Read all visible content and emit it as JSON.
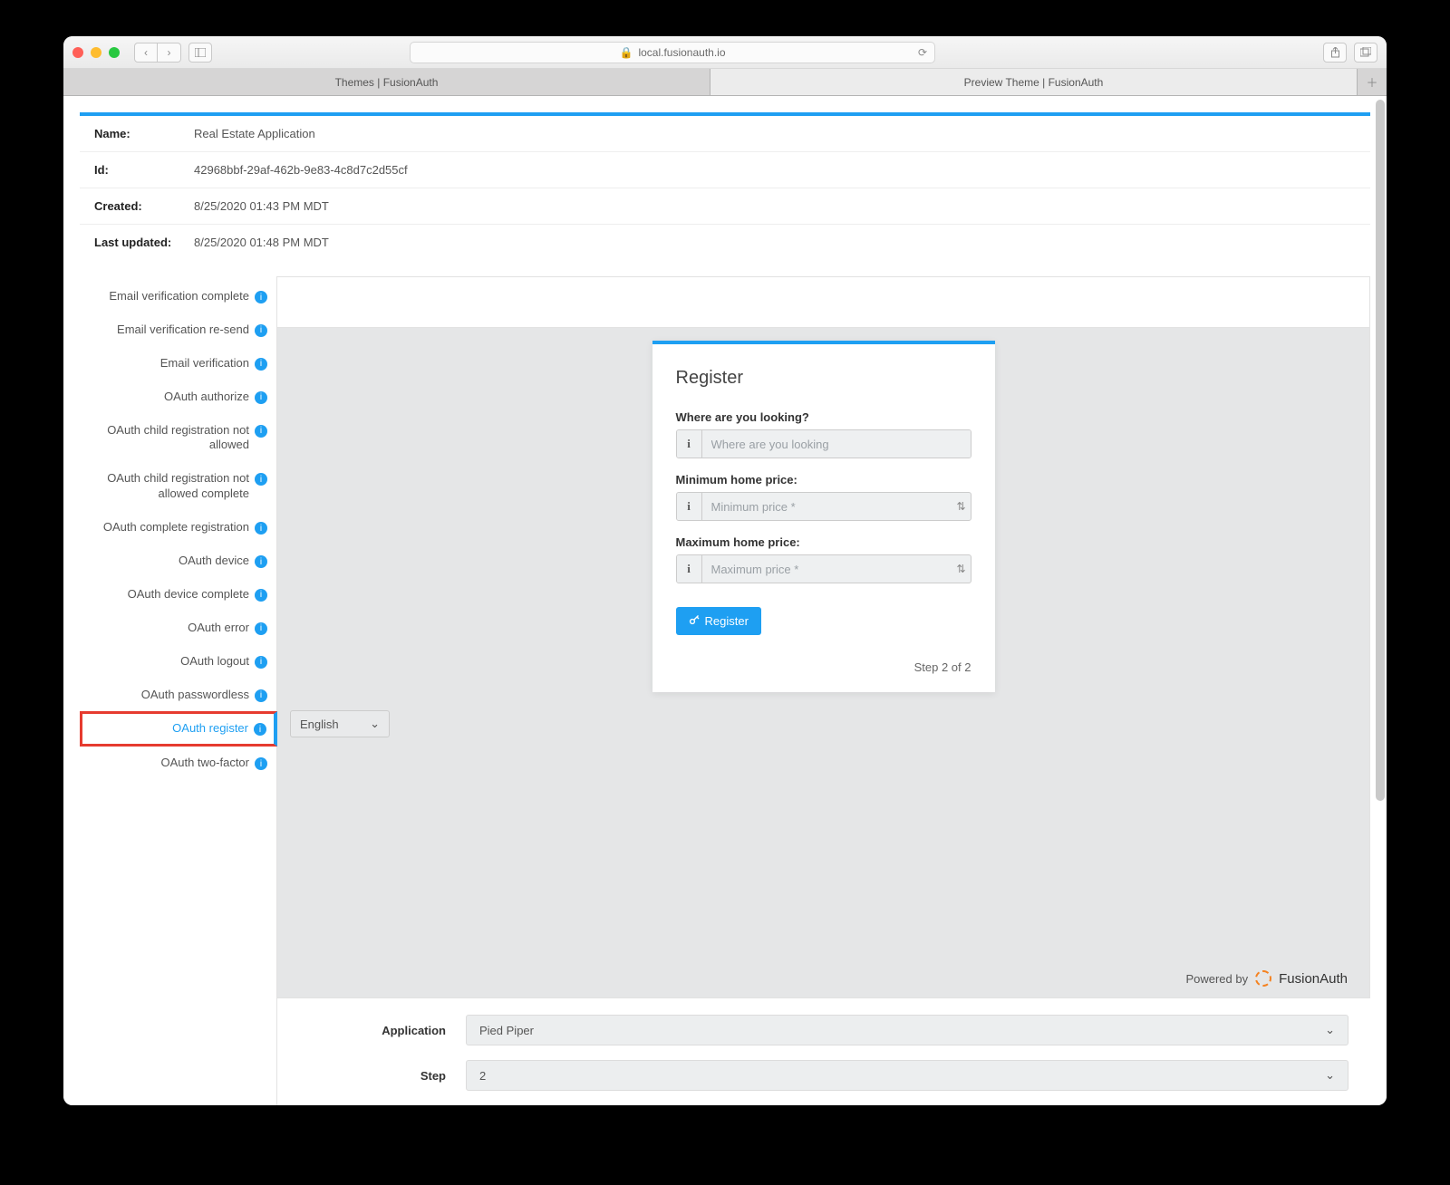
{
  "browser": {
    "url": "local.fusionauth.io",
    "tabs": [
      "Themes | FusionAuth",
      "Preview Theme | FusionAuth"
    ],
    "active_tab": 1
  },
  "meta": {
    "name_label": "Name:",
    "name_value": "Real Estate Application",
    "id_label": "Id:",
    "id_value": "42968bbf-29af-462b-9e83-4c8d7c2d55cf",
    "created_label": "Created:",
    "created_value": "8/25/2020 01:43 PM MDT",
    "updated_label": "Last updated:",
    "updated_value": "8/25/2020 01:48 PM MDT"
  },
  "sidebar": {
    "items": [
      "Email verification complete",
      "Email verification re-send",
      "Email verification",
      "OAuth authorize",
      "OAuth child registration not allowed",
      "OAuth child registration not allowed complete",
      "OAuth complete registration",
      "OAuth device",
      "OAuth device complete",
      "OAuth error",
      "OAuth logout",
      "OAuth passwordless",
      "OAuth register",
      "OAuth two-factor"
    ],
    "active_index": 12
  },
  "card": {
    "title": "Register",
    "f1_label": "Where are you looking?",
    "f1_placeholder": "Where are you looking",
    "f2_label": "Minimum home price:",
    "f2_placeholder": "Minimum price *",
    "f3_label": "Maximum home price:",
    "f3_placeholder": "Maximum price *",
    "submit": "Register",
    "step": "Step 2 of 2"
  },
  "language": "English",
  "powered": "Powered by",
  "brand": "FusionAuth",
  "settings": {
    "app_label": "Application",
    "app_value": "Pied Piper",
    "step_label": "Step",
    "step_value": "2"
  }
}
